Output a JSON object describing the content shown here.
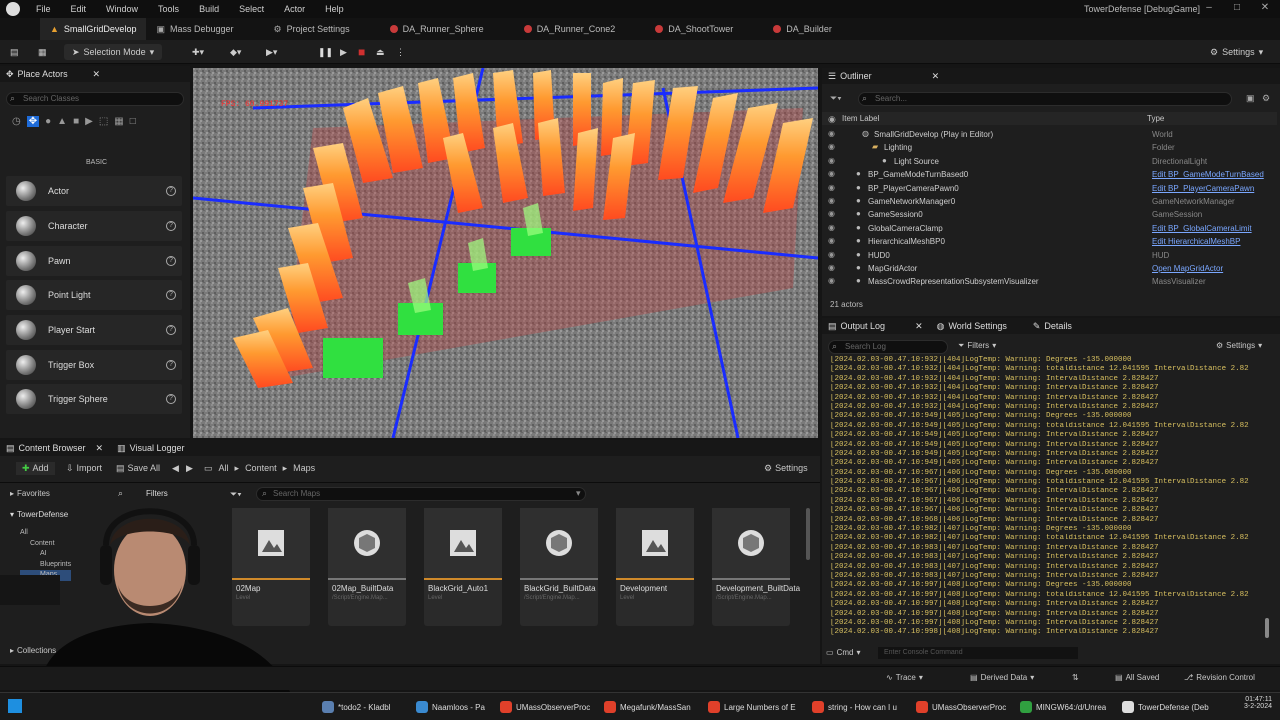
{
  "menu": [
    "File",
    "Edit",
    "Window",
    "Tools",
    "Build",
    "Select",
    "Actor",
    "Help"
  ],
  "window_title": "TowerDefense [DebugGame]",
  "doc_tabs": [
    {
      "label": "SmallGridDevelop"
    },
    {
      "label": "Mass Debugger"
    },
    {
      "label": "Project Settings"
    },
    {
      "label": "DA_Runner_Sphere"
    },
    {
      "label": "DA_Runner_Cone2"
    },
    {
      "label": "DA_ShootTower"
    },
    {
      "label": "DA_Builder"
    }
  ],
  "toolbar": {
    "selection_mode": "Selection Mode",
    "settings": "Settings"
  },
  "place_actors": {
    "title": "Place Actors",
    "search_placeholder": "Search Classes",
    "category": "BASIC",
    "items": [
      "Actor",
      "Character",
      "Pawn",
      "Point Light",
      "Player Start",
      "Trigger Box",
      "Trigger Sphere"
    ]
  },
  "viewport": {
    "fps": "FPS: 60.991737"
  },
  "outliner": {
    "title": "Outliner",
    "search_placeholder": "Search...",
    "col_label": "Item Label",
    "col_type": "Type",
    "rows": [
      {
        "name": "SmallGridDevelop (Play in Editor)",
        "type": "World",
        "link": false
      },
      {
        "name": "Lighting",
        "type": "Folder",
        "link": false
      },
      {
        "name": "Light Source",
        "type": "DirectionalLight",
        "link": false
      },
      {
        "name": "BP_GameModeTurnBased0",
        "type": "Edit BP_GameModeTurnBased",
        "link": true
      },
      {
        "name": "BP_PlayerCameraPawn0",
        "type": "Edit BP_PlayerCameraPawn",
        "link": true
      },
      {
        "name": "GameNetworkManager0",
        "type": "GameNetworkManager",
        "link": false
      },
      {
        "name": "GameSession0",
        "type": "GameSession",
        "link": false
      },
      {
        "name": "GlobalCameraClamp",
        "type": "Edit BP_GlobalCameraLimit",
        "link": true
      },
      {
        "name": "HierarchicalMeshBP0",
        "type": "Edit HierarchicalMeshBP",
        "link": true
      },
      {
        "name": "HUD0",
        "type": "HUD",
        "link": false
      },
      {
        "name": "MapGridActor",
        "type": "Open MapGridActor",
        "link": true
      },
      {
        "name": "MassCrowdRepresentationSubsystemVisualizer",
        "type": "MassVisualizer",
        "link": false
      }
    ],
    "count": "21 actors"
  },
  "output": {
    "tabs": [
      "Output Log",
      "World Settings",
      "Details"
    ],
    "search_placeholder": "Search Log",
    "filters": "Filters",
    "settings": "Settings",
    "lines": [
      "[2024.02.03-00.47.10:932][404]LogTemp: Warning: Degrees -135.000000",
      "[2024.02.03-00.47.10:932][404]LogTemp: Warning: totaldistance 12.041595 IntervalDistance 2.82",
      "[2024.02.03-00.47.10:932][404]LogTemp: Warning: IntervalDistance 2.828427",
      "[2024.02.03-00.47.10:932][404]LogTemp: Warning: IntervalDistance 2.828427",
      "[2024.02.03-00.47.10:932][404]LogTemp: Warning: IntervalDistance 2.828427",
      "[2024.02.03-00.47.10:932][404]LogTemp: Warning: IntervalDistance 2.828427",
      "[2024.02.03-00.47.10:949][405]LogTemp: Warning: Degrees -135.000000",
      "[2024.02.03-00.47.10:949][405]LogTemp: Warning: totaldistance 12.041595 IntervalDistance 2.82",
      "[2024.02.03-00.47.10:949][405]LogTemp: Warning: IntervalDistance 2.828427",
      "[2024.02.03-00.47.10:949][405]LogTemp: Warning: IntervalDistance 2.828427",
      "[2024.02.03-00.47.10:949][405]LogTemp: Warning: IntervalDistance 2.828427",
      "[2024.02.03-00.47.10:949][405]LogTemp: Warning: IntervalDistance 2.828427",
      "[2024.02.03-00.47.10:967][406]LogTemp: Warning: Degrees -135.000000",
      "[2024.02.03-00.47.10:967][406]LogTemp: Warning: totaldistance 12.041595 IntervalDistance 2.82",
      "[2024.02.03-00.47.10:967][406]LogTemp: Warning: IntervalDistance 2.828427",
      "[2024.02.03-00.47.10:967][406]LogTemp: Warning: IntervalDistance 2.828427",
      "[2024.02.03-00.47.10:967][406]LogTemp: Warning: IntervalDistance 2.828427",
      "[2024.02.03-00.47.10:968][406]LogTemp: Warning: IntervalDistance 2.828427",
      "[2024.02.03-00.47.10:982][407]LogTemp: Warning: Degrees -135.000000",
      "[2024.02.03-00.47.10:982][407]LogTemp: Warning: totaldistance 12.041595 IntervalDistance 2.82",
      "[2024.02.03-00.47.10:983][407]LogTemp: Warning: IntervalDistance 2.828427",
      "[2024.02.03-00.47.10:983][407]LogTemp: Warning: IntervalDistance 2.828427",
      "[2024.02.03-00.47.10:983][407]LogTemp: Warning: IntervalDistance 2.828427",
      "[2024.02.03-00.47.10:983][407]LogTemp: Warning: IntervalDistance 2.828427",
      "[2024.02.03-00.47.10:997][408]LogTemp: Warning: Degrees -135.000000",
      "[2024.02.03-00.47.10:997][408]LogTemp: Warning: totaldistance 12.041595 IntervalDistance 2.82",
      "[2024.02.03-00.47.10:997][408]LogTemp: Warning: IntervalDistance 2.828427",
      "[2024.02.03-00.47.10:997][408]LogTemp: Warning: IntervalDistance 2.828427",
      "[2024.02.03-00.47.10:997][408]LogTemp: Warning: IntervalDistance 2.828427",
      "[2024.02.03-00.47.10:998][408]LogTemp: Warning: IntervalDistance 2.828427"
    ],
    "cmd": "Cmd",
    "console_placeholder": "Enter Console Command"
  },
  "content_browser": {
    "tabs": [
      "Content Browser",
      "Visual Logger"
    ],
    "add": "Add",
    "import": "Import",
    "save_all": "Save All",
    "path": [
      "All",
      "Content",
      "Maps"
    ],
    "settings": "Settings",
    "favorites": "Favorites",
    "filters": "Filters",
    "project": "TowerDefense",
    "search_placeholder": "Search Maps",
    "tree": [
      "All",
      "Content",
      "AI",
      "Blueprints",
      "Maps"
    ],
    "collections": "Collections",
    "assets": [
      {
        "name": "02Map",
        "sub": "Level",
        "kind": "level"
      },
      {
        "name": "02Map_BuiltData",
        "sub": "/Script/Engine.Map...",
        "kind": "data"
      },
      {
        "name": "BlackGrid_Auto1",
        "sub": "Level",
        "kind": "level"
      },
      {
        "name": "BlackGrid_BuiltData",
        "sub": "/Script/Engine.Map...",
        "kind": "data"
      },
      {
        "name": "Development",
        "sub": "Level",
        "kind": "level"
      },
      {
        "name": "Development_BuiltData",
        "sub": "/Script/Engine.Map...",
        "kind": "data"
      }
    ]
  },
  "statusbar": {
    "trace": "Trace",
    "derived": "Derived Data",
    "saved": "All Saved",
    "revision": "Revision Control"
  },
  "taskbar": {
    "items": [
      "*todo2 - Kladbl",
      "Naamloos - Pa",
      "UMassObserverProc",
      "Megafunk/MassSan",
      "Large Numbers of E",
      "string - How can I u",
      "UMassObserverProc",
      "MINGW64:/d/Unrea",
      "TowerDefense (Deb"
    ],
    "time": "01:47:11",
    "date": "3-2-2024"
  },
  "colors": {
    "accent": "#1e6bd8",
    "log": "#d8c060",
    "link": "#7aa7ff",
    "level_bar": "#d08a2a"
  }
}
